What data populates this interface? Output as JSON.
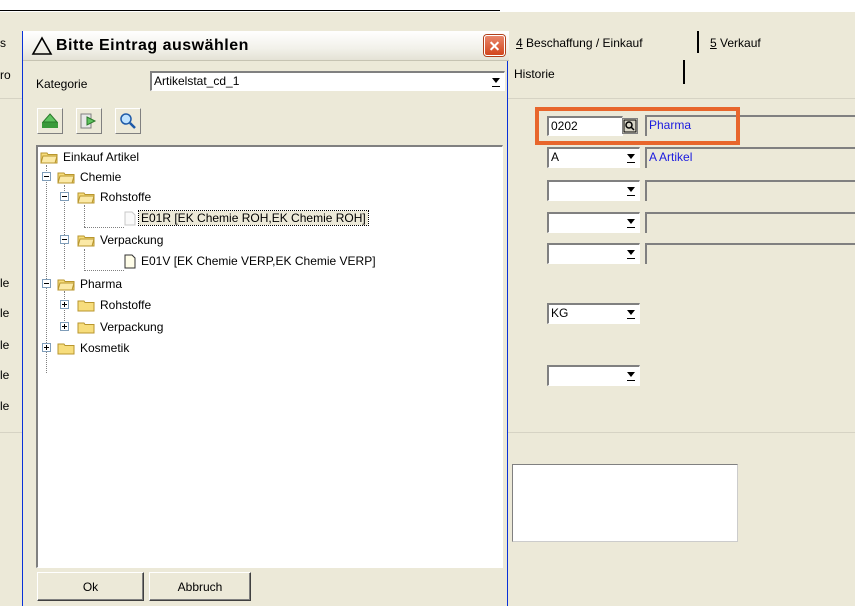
{
  "background_app": {
    "left_cut_labels": [
      "s",
      "ro",
      "le",
      "le",
      "le",
      "le",
      "le"
    ],
    "tabs": [
      {
        "key": "4",
        "label": " Beschaffung / Einkauf"
      },
      {
        "key": "5",
        "label": " Verkauf"
      }
    ],
    "subtab": "Historie",
    "fields": {
      "code_value": "0202",
      "code_desc": "Pharma",
      "class_value": "A",
      "class_desc": "A Artikel",
      "unit_value": "KG"
    }
  },
  "dialog": {
    "title": "Bitte Eintrag auswählen",
    "kategorie_label": "Kategorie",
    "kategorie_value": "Artikelstat_cd_1",
    "toolbar": [
      "expand-all-icon",
      "collapse-all-icon",
      "search-icon"
    ],
    "tree": [
      {
        "label": "Einkauf Artikel"
      },
      {
        "label": "Chemie"
      },
      {
        "label": "Rohstoffe"
      },
      {
        "label": "E01R [EK Chemie ROH,EK Chemie ROH]"
      },
      {
        "label": "Verpackung"
      },
      {
        "label": "E01V [EK Chemie VERP,EK Chemie VERP]"
      },
      {
        "label": "Pharma"
      },
      {
        "label": "Rohstoffe"
      },
      {
        "label": "Verpackung"
      },
      {
        "label": "Kosmetik"
      }
    ],
    "ok_label": "Ok",
    "cancel_label": "Abbruch"
  },
  "colors": {
    "highlight": "#e8662c",
    "link_text": "#1a1ae0",
    "window_bg": "#ece9d8"
  }
}
